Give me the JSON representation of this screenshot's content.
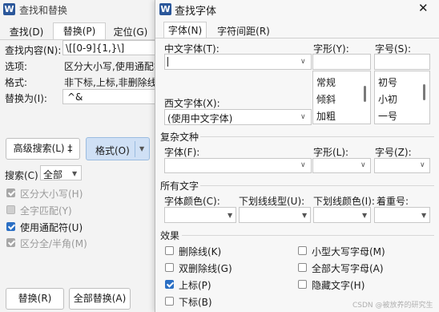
{
  "left": {
    "title": "查找和替换",
    "tabs": [
      "查找(D)",
      "替换(P)",
      "定位(G)"
    ],
    "find_label": "查找内容(N):",
    "find_value": "\\[[0-9]{1,}\\]",
    "options_label": "选项:",
    "options_value": "区分大小写,使用通配符",
    "format_label": "格式:",
    "format_value": "非下标,上标,非删除线",
    "replace_label": "替换为(I):",
    "replace_value": "^&",
    "advanced_button": "高级搜索(L) ‡",
    "format_button": "格式(O)",
    "search_label": "搜索(C)",
    "search_value": "全部",
    "checks": [
      {
        "label": "区分大小写(H)",
        "checked": true,
        "disabled": true
      },
      {
        "label": "全字匹配(Y)",
        "checked": false,
        "disabled": true
      },
      {
        "label": "使用通配符(U)",
        "checked": true,
        "disabled": false
      },
      {
        "label": "区分全/半角(M)",
        "checked": true,
        "disabled": true
      }
    ],
    "replace_button": "替换(R)",
    "replace_all_button": "全部替换(A)"
  },
  "font_dialog": {
    "title": "查找字体",
    "close_glyph": "✕",
    "tabs": [
      "字体(N)",
      "字符间距(R)"
    ],
    "cn_font_label": "中文字体(T):",
    "cn_font_value": "",
    "style_label": "字形(Y):",
    "size_label": "字号(S):",
    "style_list": [
      "常规",
      "倾斜",
      "加粗"
    ],
    "size_list": [
      "初号",
      "小初",
      "一号"
    ],
    "west_font_label": "西文字体(X):",
    "west_font_value": "(使用中文字体)",
    "complex_section": "复杂文种",
    "complex_font_label": "字体(F):",
    "complex_style_label": "字形(L):",
    "complex_size_label": "字号(Z):",
    "all_text_section": "所有文字",
    "color_label": "字体颜色(C):",
    "underline_style_label": "下划线线型(U):",
    "underline_color_label": "下划线颜色(I):",
    "emphasis_label": "着重号:",
    "effects_section": "效果",
    "effects_left": [
      {
        "label": "删除线(K)",
        "checked": false
      },
      {
        "label": "双删除线(G)",
        "checked": false
      },
      {
        "label": "上标(P)",
        "checked": true
      },
      {
        "label": "下标(B)",
        "checked": false
      }
    ],
    "effects_right": [
      {
        "label": "小型大写字母(M)",
        "checked": false
      },
      {
        "label": "全部大写字母(A)",
        "checked": false
      },
      {
        "label": "隐藏文字(H)",
        "checked": false
      }
    ]
  },
  "watermark": "CSDN @被放养的研究生"
}
